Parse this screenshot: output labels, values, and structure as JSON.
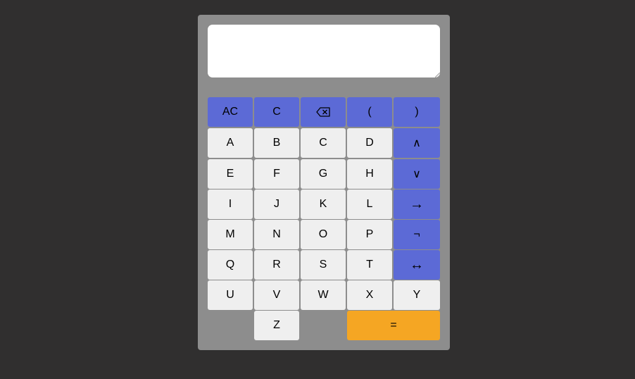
{
  "display": {
    "value": ""
  },
  "keys": {
    "ac": "AC",
    "c": "C",
    "backspace_icon": "backspace-icon",
    "open_paren": "(",
    "close_paren": ")",
    "and": "∧",
    "or": "∨",
    "implies": "→",
    "not": "¬",
    "iff": "↔",
    "equals": "=",
    "letters": [
      "A",
      "B",
      "C",
      "D",
      "E",
      "F",
      "G",
      "H",
      "I",
      "J",
      "K",
      "L",
      "M",
      "N",
      "O",
      "P",
      "Q",
      "R",
      "S",
      "T",
      "U",
      "V",
      "W",
      "X",
      "Y",
      "Z"
    ]
  },
  "colors": {
    "background": "#302f2f",
    "panel": "#8d8d8d",
    "operator": "#5c6ad6",
    "letter": "#efefef",
    "equals": "#f5a623"
  }
}
